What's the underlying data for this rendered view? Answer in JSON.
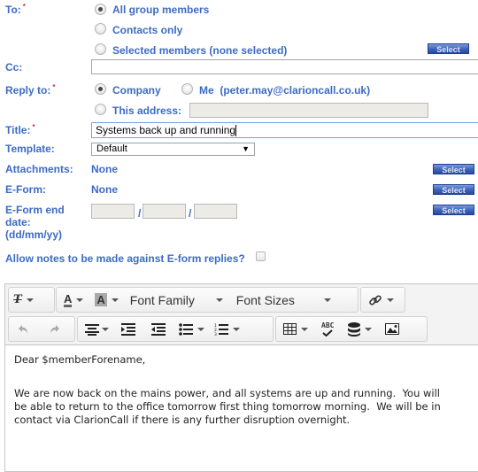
{
  "form": {
    "to": {
      "label": "To:",
      "required_mark": "*",
      "options": [
        {
          "label": "All group members",
          "checked": true
        },
        {
          "label": "Contacts only",
          "checked": false
        },
        {
          "label": "Selected members (none selected)",
          "checked": false
        }
      ],
      "select_button": "Select"
    },
    "cc": {
      "label": "Cc:",
      "value": ""
    },
    "reply_to": {
      "label": "Reply to:",
      "required_mark": "*",
      "options": [
        {
          "label": "Company",
          "checked": true
        },
        {
          "label": "Me  (peter.may@clarioncall.co.uk)",
          "checked": false
        },
        {
          "label": "This address:",
          "checked": false
        }
      ],
      "address_value": ""
    },
    "title": {
      "label": "Title:",
      "required_mark": "*",
      "value": "Systems back up and running"
    },
    "template": {
      "label": "Template:",
      "selected": "Default",
      "arrow": "▼"
    },
    "attachments": {
      "label": "Attachments:",
      "value": "None",
      "select_button": "Select"
    },
    "eform": {
      "label": "E-Form:",
      "value": "None",
      "select_button": "Select"
    },
    "eform_end_date": {
      "label_line1": "E-Form end",
      "label_line2": "date:",
      "label_line3": "(dd/mm/yy)",
      "day": "",
      "month": "",
      "year": "",
      "separator": "/",
      "select_button": "Select"
    },
    "allow_notes": {
      "label": "Allow notes to be made against E-form replies?",
      "checked": false
    }
  },
  "editor": {
    "toolbar": {
      "row1": [
        {
          "icon": "clear-formatting-icon",
          "dropdown": true
        },
        {
          "icon": "text-color-icon",
          "dropdown": true
        },
        {
          "icon": "background-color-icon",
          "dropdown": true
        },
        {
          "label": "Font Family",
          "dropdown": true
        },
        {
          "label": "Font Sizes",
          "dropdown": true
        },
        {
          "icon": "link-icon",
          "dropdown": true
        }
      ],
      "row2": [
        {
          "icon": "undo-icon"
        },
        {
          "icon": "redo-icon"
        },
        {
          "icon": "align-icon",
          "dropdown": true
        },
        {
          "icon": "indent-icon"
        },
        {
          "icon": "outdent-icon"
        },
        {
          "icon": "bullet-list-icon",
          "dropdown": true
        },
        {
          "icon": "numbered-list-icon",
          "dropdown": true
        },
        {
          "icon": "table-icon",
          "dropdown": true
        },
        {
          "icon": "spellcheck-icon",
          "label": "ABC"
        },
        {
          "icon": "database-icon",
          "dropdown": true
        },
        {
          "icon": "image-icon"
        }
      ],
      "font_family_label": "Font Family",
      "font_sizes_label": "Font Sizes",
      "spellcheck_text": "ABC",
      "text_color_glyph": "A",
      "bg_color_glyph": "A",
      "clear_glyph": "T"
    },
    "content": {
      "greeting": "Dear $memberForename,",
      "body": "We are now back on the mains power, and all systems are up and running.  You will be able to return to the office tomorrow first thing tomorrow morning.  We will be in contact via ClarionCall if there is any further disruption overnight."
    }
  },
  "colors": {
    "label_blue": "#3d6bc4",
    "required_red": "#cc3333",
    "button_blue": "#3f66c0",
    "disabled_input": "#ecebe6"
  }
}
